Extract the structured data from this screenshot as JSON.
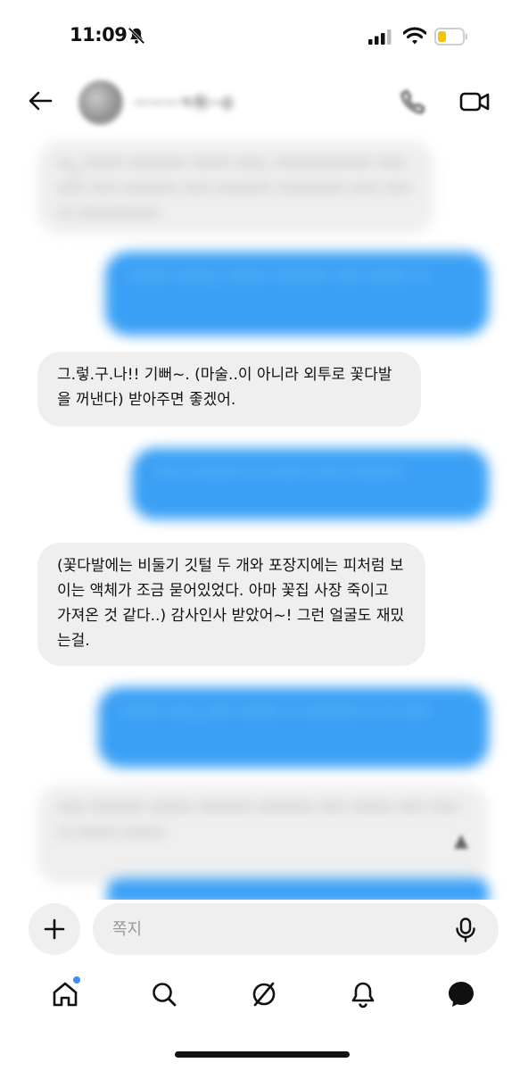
{
  "status_bar": {
    "time": "11:09",
    "icons": [
      "bell-off-icon",
      "signal-icon",
      "wifi-icon",
      "battery-icon"
    ],
    "battery_color": "#f5c400"
  },
  "header": {
    "contact_name": "ㅡㅡㅡㅋ쥐ㅡ0",
    "icons": [
      "back-arrow-icon",
      "phone-icon",
      "video-call-icon"
    ]
  },
  "messages": [
    {
      "direction": "in",
      "blurred": true,
      "text": "ㅡ_ ㅡㅡㅡ ㅡㅡㅡㅡ ㅡㅡㅡ ㅡㅡ. ㅡㅡㅡㅡㅡㅡㅡ ㅡㅡㅡㅡ ㅡㅡ ㅡㅡㅡㅡ ㅡㅡ ㅡㅡㅡㅡ ㅡㅡㅡㅡㅡ ㅡㅡ ㅡㅡㅡ ㅡㅡㅡㅡㅡㅡ"
    },
    {
      "direction": "out",
      "blurred": true,
      "text": "ㅡㅡㅡ ㅡㅡㅡ. ㅡㅡㅡ ㅡㅡㅡㅡ ㅡㅡ ㅡㅡㅡ ㅡ"
    },
    {
      "direction": "in",
      "blurred": false,
      "text": "그.렇.구.나!! 기뻐~. (마술..이 아니라 외투로 꽃다발을 꺼낸다) 받아주면 좋겠어."
    },
    {
      "direction": "out",
      "blurred": true,
      "text": "ㅡㅡ ㅡㅡㅡㅡ ㅡ ㅡㅡㅡ ㅡㅡ ㅡㅡㅡㅡ"
    },
    {
      "direction": "in",
      "blurred": false,
      "text": "(꽃다발에는 비둘기 깃털 두 개와 포장지에는 피처럼 보이는 액체가 조금 묻어있었다. 아마 꽃집 사장 죽이고 가져온 것 같다..) 감사인사 받았어~! 그런 얼굴도 재밌는걸."
    },
    {
      "direction": "out",
      "blurred": true,
      "text": "ㅡㅡㅡ ㅡㅡ, ㅡㅡ ㅡㅡㅡ ㅡ ㅡㅡㅡㅡ ㅡ ㅡ ㅡㅡ"
    },
    {
      "direction": "in",
      "blurred": true,
      "text": "ㅡㅡ ㅡㅡㅡㅡ ㅡㅡㅡ ㅡㅡㅡㅡ ㅡㅡㅡㅡ ㅡㅡ ㅡㅡㅡ ㅡㅡ ㅡㅡㅡ ㅡㅡㅡ ㅡㅡㅡ"
    },
    {
      "direction": "out",
      "blurred": true,
      "text": ""
    }
  ],
  "composer": {
    "placeholder": "쪽지"
  },
  "bottom_nav": {
    "items": [
      "home-icon",
      "search-icon",
      "explore-icon",
      "activity-icon",
      "messages-icon"
    ],
    "accent": "#3b8ff5"
  }
}
